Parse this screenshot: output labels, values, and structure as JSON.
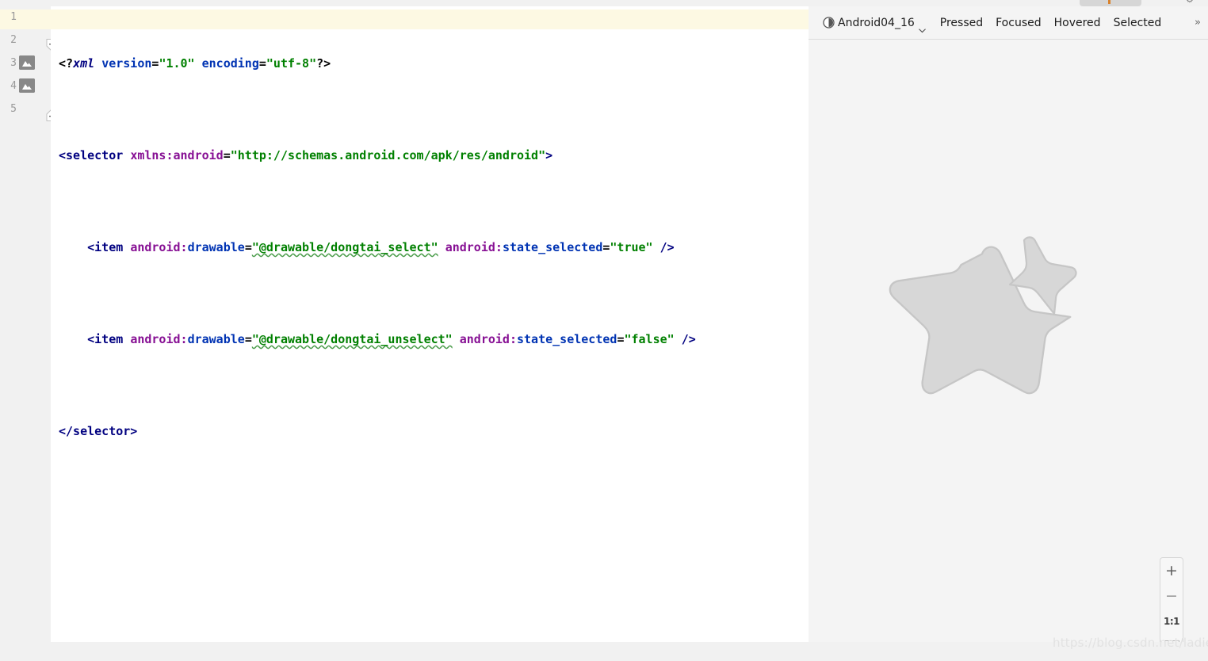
{
  "window": {
    "background_color": "#f1f1f1",
    "watermark": "https://blog.csdn.net/ladiez"
  },
  "editor": {
    "background_color": "#ffffff",
    "gutter_background": "#f1f1f1",
    "current_line_highlight": "#fdf9e3",
    "inspection_status_icon": "double-check-icon",
    "inspection_status_color": "#3f9142",
    "lines": [
      {
        "number": "1",
        "gutter_icon": "",
        "fold": "",
        "current": true
      },
      {
        "number": "2",
        "gutter_icon": "",
        "fold": "collapse"
      },
      {
        "number": "3",
        "gutter_icon": "image-preview-icon",
        "fold": ""
      },
      {
        "number": "4",
        "gutter_icon": "image-preview-icon",
        "fold": ""
      },
      {
        "number": "5",
        "gutter_icon": "",
        "fold": "collapse"
      }
    ],
    "code": {
      "line1": "<?xml version=\"1.0\" encoding=\"utf-8\"?>",
      "line2": "<selector xmlns:android=\"http://schemas.android.com/apk/res/android\">",
      "line3": "    <item android:drawable=\"@drawable/dongtai_select\" android:state_selected=\"true\" />",
      "line4": "    <item android:drawable=\"@drawable/dongtai_unselect\" android:state_selected=\"false\" />",
      "line5": "</selector>"
    },
    "tokens": {
      "xml_decl_open": "<?",
      "xml_decl_name": "xml",
      "attr_version": "version",
      "val_version": "\"1.0\"",
      "attr_encoding": "encoding",
      "val_encoding": "\"utf-8\"",
      "xml_decl_close": "?>",
      "tag_selector_open": "<selector",
      "attr_xmlns": "xmlns:android",
      "val_xmlns": "\"http://schemas.android.com/apk/res/android\"",
      "gt": ">",
      "tag_item": "<item",
      "ns_android": "android:",
      "attr_drawable": "drawable",
      "val_select": "\"@drawable/dongtai_select\"",
      "val_unselect": "\"@drawable/dongtai_unselect\"",
      "attr_state_selected": "state_selected",
      "val_true": "\"true\"",
      "val_false": "\"false\"",
      "selfclose": "/>",
      "tag_selector_close": "</selector>",
      "eq": "=",
      "drawable_select_name": "dongtai_select",
      "drawable_unselect_name": "dongtai_unselect"
    },
    "colors": {
      "tag": "#000080",
      "namespace": "#871094",
      "attribute": "#0033b3",
      "value": "#008000",
      "warning_squiggle": "#4a9c4a"
    }
  },
  "preview": {
    "background_color": "#f4f4f4",
    "toolbar": {
      "theme_icon": "contrast-circle-icon",
      "device_name": "Android04_16",
      "device_chevron": "chevron-down-icon",
      "states": [
        "Pressed",
        "Focused",
        "Hovered",
        "Selected"
      ],
      "overflow_label": "»"
    },
    "drawable": {
      "shape": "rounded-star",
      "fill_color": "#d7d7d7",
      "stroke_color": "#c4c4c4",
      "fragment": "detached-point-top-right"
    },
    "zoom_controls": {
      "zoom_in": "+",
      "zoom_out": "−",
      "actual_size": "1:1",
      "fit_to_screen": "fit-screen-icon"
    }
  }
}
